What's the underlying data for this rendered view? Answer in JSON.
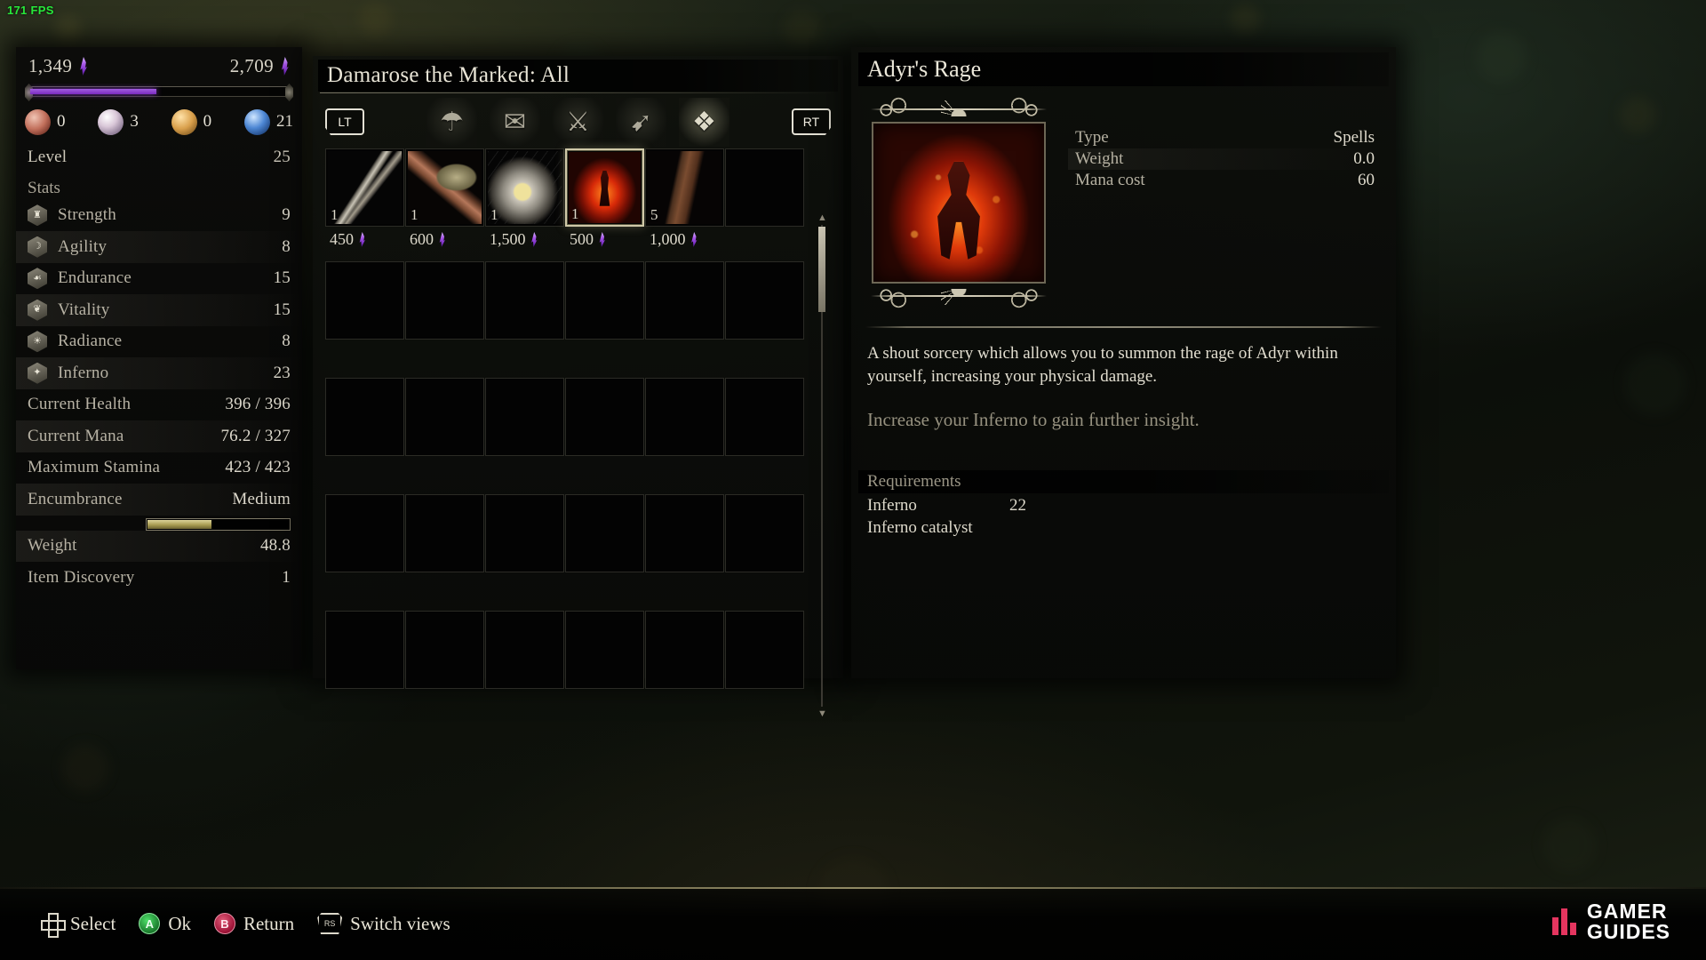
{
  "hud": {
    "fps": "171 FPS"
  },
  "player": {
    "souls_current": "1,349",
    "souls_max": "2,709",
    "xp_percent": 49,
    "consumables": [
      {
        "icon": "bloody-hand-icon",
        "value": "0"
      },
      {
        "icon": "pearl-icon",
        "value": "3"
      },
      {
        "icon": "amber-stone-icon",
        "value": "0"
      },
      {
        "icon": "blue-orb-icon",
        "value": "21"
      }
    ],
    "level_label": "Level",
    "level_value": "25",
    "stats_header": "Stats",
    "stats": [
      {
        "icon": "strength-icon",
        "glyph": "♜",
        "label": "Strength",
        "value": "9"
      },
      {
        "icon": "agility-icon",
        "glyph": "☽",
        "label": "Agility",
        "value": "8"
      },
      {
        "icon": "endurance-icon",
        "glyph": "☙",
        "label": "Endurance",
        "value": "15"
      },
      {
        "icon": "vitality-icon",
        "glyph": "❦",
        "label": "Vitality",
        "value": "15"
      },
      {
        "icon": "radiance-icon",
        "glyph": "☀",
        "label": "Radiance",
        "value": "8"
      },
      {
        "icon": "inferno-icon",
        "glyph": "✦",
        "label": "Inferno",
        "value": "23"
      }
    ],
    "derived": [
      {
        "label": "Current Health",
        "value": "396 / 396"
      },
      {
        "label": "Current Mana",
        "value": "76.2 / 327"
      },
      {
        "label": "Maximum Stamina",
        "value": "423 / 423"
      },
      {
        "label": "Encumbrance",
        "value": "Medium"
      }
    ],
    "encumbrance_percent": 45,
    "weight_label": "Weight",
    "weight_value": "48.8",
    "discovery_label": "Item Discovery",
    "discovery_value": "1"
  },
  "inventory": {
    "title": "Damarose the Marked: All",
    "bumper_left": "LT",
    "bumper_right": "RT",
    "categories": [
      {
        "name": "pouch-category-icon",
        "glyph": "☂",
        "active": false
      },
      {
        "name": "scroll-category-icon",
        "glyph": "✉",
        "active": false
      },
      {
        "name": "weapon-category-icon",
        "glyph": "⚔",
        "active": false
      },
      {
        "name": "ammo-category-icon",
        "glyph": "➹",
        "active": false
      },
      {
        "name": "spellbook-category-icon",
        "glyph": "❖",
        "active": true
      }
    ],
    "items": [
      {
        "name": "item-dagger",
        "art": "a-dagger",
        "qty": "1",
        "price": "450",
        "selected": false
      },
      {
        "name": "item-axe",
        "art": "a-axe",
        "qty": "1",
        "price": "600",
        "selected": false
      },
      {
        "name": "item-bomb",
        "art": "a-bomb",
        "qty": "1",
        "price": "1,500",
        "selected": false
      },
      {
        "name": "item-adyrs-rage",
        "art": "a-rage",
        "qty": "1",
        "price": "500",
        "selected": true
      },
      {
        "name": "item-club",
        "art": "a-club",
        "qty": "5",
        "price": "1,000",
        "selected": false
      }
    ],
    "empty_rows": 4,
    "columns": 6
  },
  "detail": {
    "title": "Adyr's Rage",
    "attributes": [
      {
        "key": "Type",
        "value": "Spells"
      },
      {
        "key": "Weight",
        "value": "0.0"
      },
      {
        "key": "Mana cost",
        "value": "60"
      }
    ],
    "description": "A shout sorcery which allows you to summon the rage of Adyr within yourself, increasing your physical damage.",
    "hint": "Increase your Inferno to gain further insight.",
    "requirements_header": "Requirements",
    "requirements": [
      {
        "key": "Inferno",
        "value": "22"
      },
      {
        "key": "Inferno catalyst",
        "value": ""
      }
    ]
  },
  "footer": {
    "hints": [
      {
        "icon": "dpad-icon",
        "label": "Select"
      },
      {
        "icon": "button-a-icon",
        "glyph": "A",
        "label": "Ok"
      },
      {
        "icon": "button-b-icon",
        "glyph": "B",
        "label": "Return"
      },
      {
        "icon": "right-stick-icon",
        "glyph": "RS",
        "label": "Switch views"
      }
    ],
    "brand_line1": "GAMER",
    "brand_line2": "GUIDES"
  }
}
